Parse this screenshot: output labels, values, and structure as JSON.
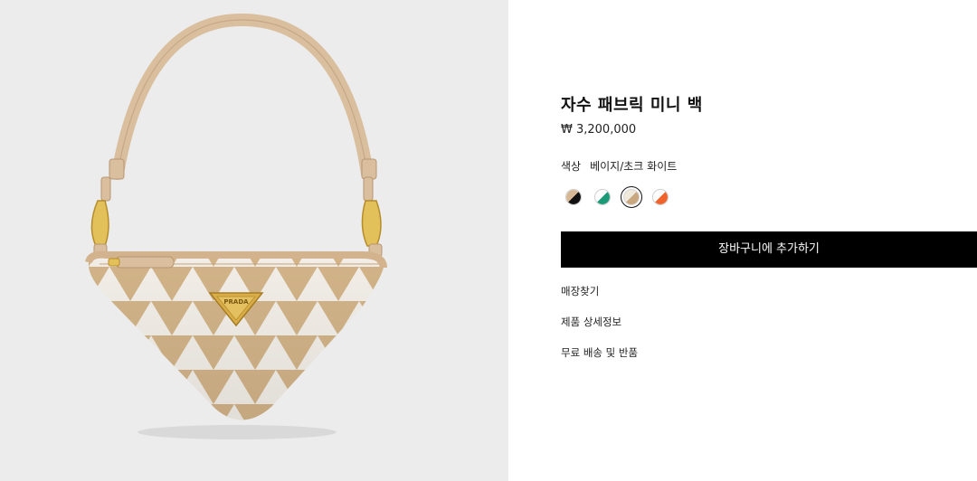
{
  "product": {
    "title": "자수 패브릭 미니 백",
    "price": "₩ 3,200,000",
    "color_label": "색상",
    "color_value": "베이지/초크 화이트",
    "swatches": [
      {
        "name": "black-beige",
        "colors": [
          "#d7b894",
          "#111111"
        ]
      },
      {
        "name": "green-white",
        "colors": [
          "#ffffff",
          "#1a9a77"
        ]
      },
      {
        "name": "beige-white",
        "colors": [
          "#efe8dc",
          "#c9a77f"
        ],
        "selected": true
      },
      {
        "name": "orange-white",
        "colors": [
          "#ffffff",
          "#f0632a"
        ]
      }
    ],
    "logo_text": "PRADA"
  },
  "actions": {
    "add_to_cart": "장바구니에 추가하기"
  },
  "links": {
    "find_store": "매장찾기",
    "product_details": "제품 상세정보",
    "shipping_returns": "무료 배송 및 반품"
  },
  "colors": {
    "gallery_bg": "#ececec",
    "button_bg": "#000000",
    "bag_beige": "#d3b489",
    "bag_white": "#f3efe8",
    "hardware_gold": "#d4a73e"
  }
}
